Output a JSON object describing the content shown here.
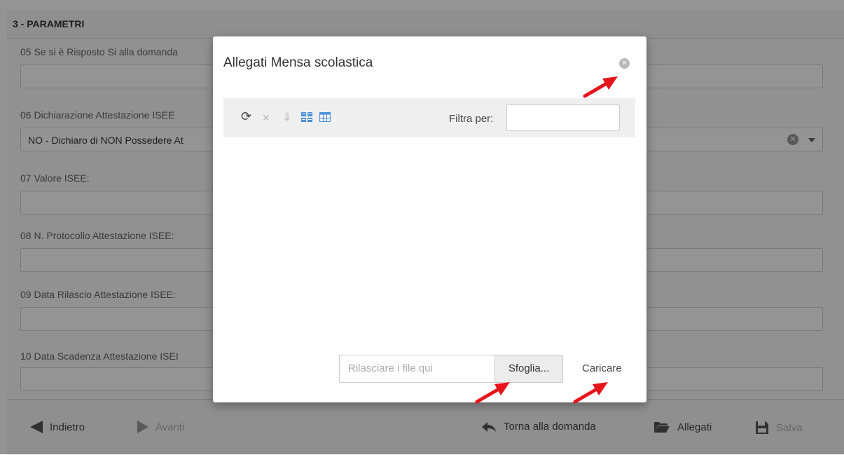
{
  "section": {
    "title": "3 - PARAMETRI"
  },
  "fields": {
    "f05_label": "05 Se si è Risposto Si alla domanda",
    "f06_label": "06 Dichiarazione Attestazione ISEE",
    "f06_value": "NO - Dichiaro di NON Possedere At",
    "f07_label": "07 Valore ISEE:",
    "f08_label": "08 N. Protocollo Attestazione ISEE:",
    "f09_label": "09 Data Rilascio Attestazione ISEE:",
    "f10_label": "10 Data Scadenza Attestazione ISEI"
  },
  "footer": {
    "back": "Indietro",
    "next": "Avanti",
    "return": "Torna alla domanda",
    "attachments": "Allegati",
    "save": "Salva"
  },
  "modal": {
    "title": "Allegati Mensa scolastica",
    "close_glyph": "✕",
    "toolbar": {
      "icons": [
        "refresh-icon",
        "delete-icon",
        "download-icon",
        "tiles-view-icon",
        "grid-view-icon"
      ],
      "refresh_glyph": "⟳",
      "delete_glyph": "✕",
      "download_glyph": "⇓",
      "filter_label": "Filtra per:",
      "filter_value": ""
    },
    "upload": {
      "drop_placeholder": "Rilasciare i file qui",
      "browse_label": "Sfoglia...",
      "upload_label": "Caricare"
    }
  },
  "colors": {
    "accent_icon": "#4a90d9",
    "arrow": "#e8141b",
    "overlay": "rgba(0,0,0,0.42)"
  }
}
